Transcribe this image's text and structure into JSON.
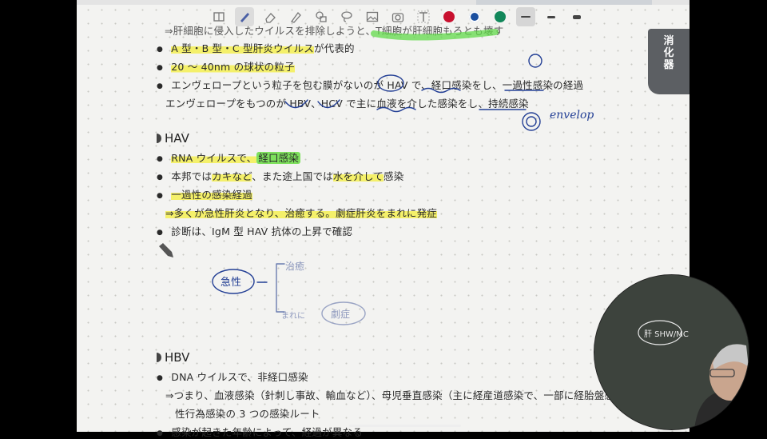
{
  "side_tab": {
    "line1": "消",
    "line2": "化",
    "line3": "器"
  },
  "toolbar": {
    "icons": [
      "book-icon",
      "pen-icon",
      "eraser-icon",
      "highlighter-icon",
      "shapes-icon",
      "lasso-icon",
      "image-icon",
      "camera-icon",
      "text-icon"
    ],
    "colors": [
      "#c8102e",
      "#1a4fa0",
      "#12875a"
    ],
    "stroke_widths": [
      "thin",
      "medium",
      "thick"
    ]
  },
  "notes": {
    "top_partial": "⇒肝細胞に侵入したウイルスを排除しようと、T細胞が肝細胞もろとも壊す",
    "line_a_part1": "A 型・B 型・C 型肝炎ウイルス",
    "line_a_part2": "が代表的",
    "line_b": "20 〜 40nm の球状の粒子",
    "line_c": "エンヴェロープという粒子を包む膜がないのが HAV で、経口感染をし、一過性感染の経過",
    "line_d": "エンヴェロープをもつのが HBV、HCV で主に血液を介した感染をし、持続感染",
    "hav_heading": "HAV",
    "hav_1_part1": "RNA ウイルスで、",
    "hav_1_part2": "経口感染",
    "hav_2_part1": "本邦では",
    "hav_2_part2": "カキなど",
    "hav_2_part3": "、また途上国では",
    "hav_2_part4": "水を介して",
    "hav_2_part5": "感染",
    "hav_3": "一過性の感染経過",
    "hav_4": "⇒多くが急性肝炎となり、治癒する。劇症肝炎をまれに発症",
    "hav_5": "診断は、IgM 型 HAV 抗体の上昇で確認",
    "hbv_heading": "HBV",
    "hbv_1": "DNA ウイルスで、非経口感染",
    "hbv_2": "⇒つまり、血液感染（針刺し事故、輸血など）、母児垂直感染（主に経産道感染で、一部に経胎盤感染）、",
    "hbv_3": "性行為感染の 3 つの感染ルート",
    "hbv_4_partial": "感染が起きた年齢によって、経過が異なる"
  },
  "handwriting": {
    "envelop": "envelop",
    "acute": "急性",
    "cure": "治癒",
    "rare": "まれに",
    "fulminant": "劇症",
    "webcam_board": "肝 SHW/MC"
  }
}
